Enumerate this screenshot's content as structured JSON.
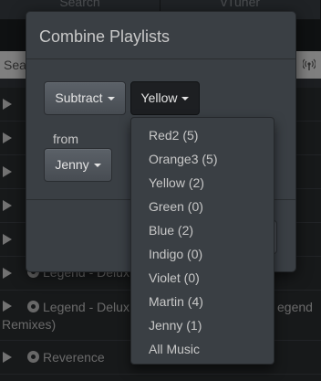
{
  "background": {
    "tabs": [
      "Search",
      "vTuner"
    ],
    "search_placeholder": "Sea",
    "rows": [
      {
        "text": ""
      },
      {
        "text": ""
      },
      {
        "text": ""
      },
      {
        "text": ""
      },
      {
        "text": ""
      },
      {
        "text": "Legend - Delux"
      },
      {
        "text": "Legend - Delux",
        "extra": "egend",
        "line2": "Remixes)"
      },
      {
        "text": "Reverence"
      }
    ]
  },
  "modal": {
    "title": "Combine Playlists",
    "operation_button": "Subtract",
    "playlist_a_button": "Yellow",
    "from_label": "from",
    "playlist_b_button": "Jenny"
  },
  "dropdown": {
    "items": [
      "Red2 (5)",
      "Orange3 (5)",
      "Yellow (2)",
      "Green (0)",
      "Blue (2)",
      "Indigo (0)",
      "Violet (0)",
      "Martin (4)",
      "Jenny (1)",
      "All Music"
    ]
  }
}
